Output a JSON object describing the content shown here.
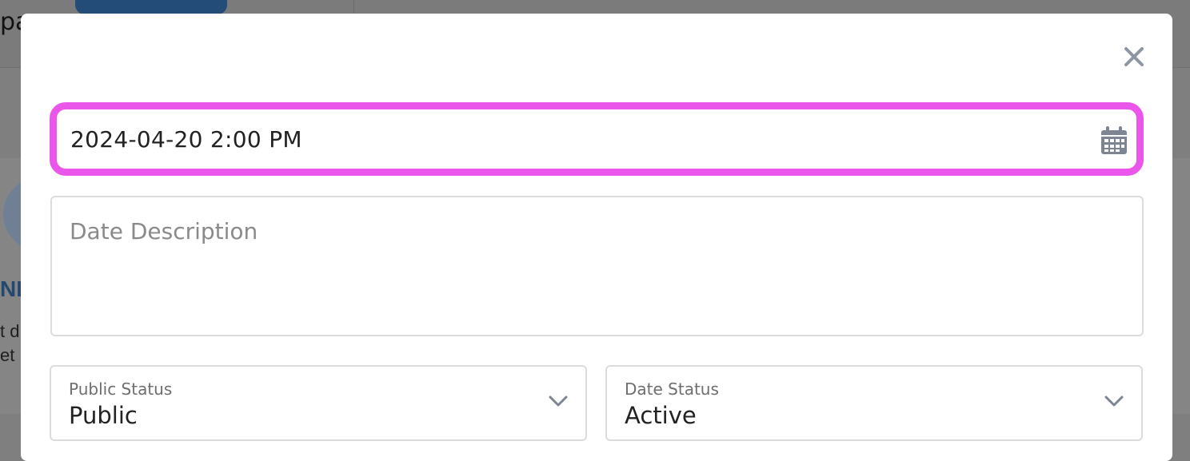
{
  "background": {
    "logo_fragment": "pa",
    "name_fragment": "NI",
    "text_line_1": "t d",
    "text_line_2": "et p"
  },
  "modal": {
    "close_icon": "close-icon",
    "date_time": {
      "value": "2024-04-20 2:00 PM",
      "icon": "calendar-icon",
      "highlight_color": "#ea55ea"
    },
    "description": {
      "placeholder": "Date Description",
      "value": ""
    },
    "public_status": {
      "label": "Public Status",
      "selected": "Public",
      "icon": "chevron-down-icon"
    },
    "date_status": {
      "label": "Date Status",
      "selected": "Active",
      "icon": "chevron-down-icon"
    }
  }
}
